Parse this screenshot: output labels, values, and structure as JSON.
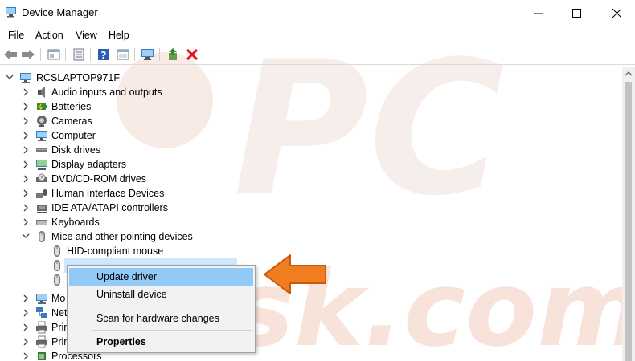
{
  "window": {
    "title": "Device Manager"
  },
  "menu": [
    "File",
    "Action",
    "View",
    "Help"
  ],
  "tree": {
    "root": "RCSLAPTOP971F",
    "items": [
      {
        "label": "Audio inputs and outputs",
        "icon": "speaker-icon"
      },
      {
        "label": "Batteries",
        "icon": "battery-icon"
      },
      {
        "label": "Cameras",
        "icon": "camera-icon"
      },
      {
        "label": "Computer",
        "icon": "monitor-icon"
      },
      {
        "label": "Disk drives",
        "icon": "disk-drive-icon"
      },
      {
        "label": "Display adapters",
        "icon": "display-adapter-icon"
      },
      {
        "label": "DVD/CD-ROM drives",
        "icon": "dvd-drive-icon"
      },
      {
        "label": "Human Interface Devices",
        "icon": "hid-icon"
      },
      {
        "label": "IDE ATA/ATAPI controllers",
        "icon": "ide-controller-icon"
      },
      {
        "label": "Keyboards",
        "icon": "keyboard-icon"
      },
      {
        "label": "Mice and other pointing devices",
        "icon": "mouse-icon"
      },
      {
        "label": "HID-compliant mouse",
        "icon": "mouse-icon"
      },
      {
        "label": "",
        "icon": "mouse-icon"
      },
      {
        "label": "",
        "icon": "mouse-icon"
      },
      {
        "label": "Mo",
        "icon": "monitor-icon"
      },
      {
        "label": "Net",
        "icon": "network-icon"
      },
      {
        "label": "Prin",
        "icon": "printer-icon"
      },
      {
        "label": "Prin",
        "icon": "printer-icon"
      },
      {
        "label": "Processors",
        "icon": "processor-icon"
      }
    ]
  },
  "context_menu": {
    "items": [
      "Update driver",
      "Uninstall device",
      "Scan for hardware changes",
      "Properties"
    ],
    "highlighted": "Update driver"
  },
  "watermark": "PC risk.com",
  "colors": {
    "highlight": "#91c9f7",
    "arrow": "#f07d1f",
    "delete": "#e81123",
    "watermark": "#f5e3dc"
  }
}
